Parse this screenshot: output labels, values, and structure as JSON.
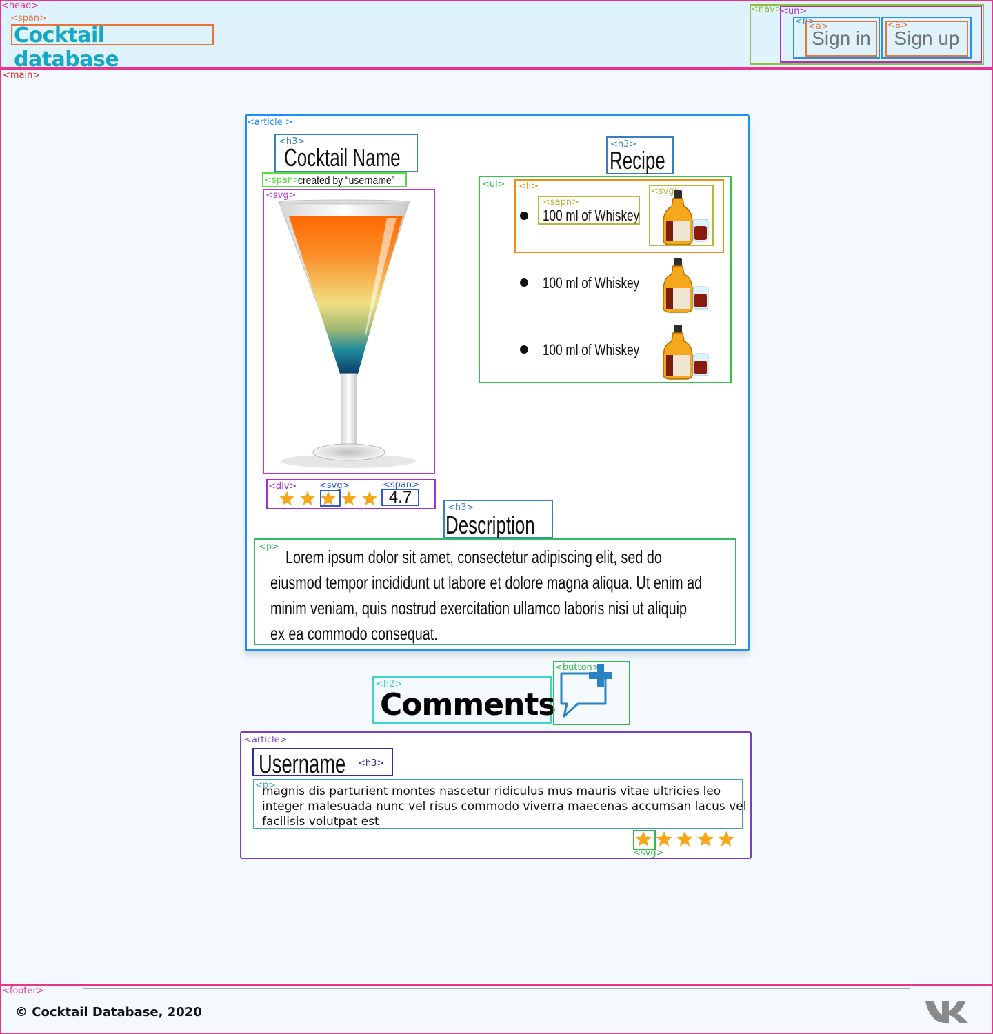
{
  "header": {
    "tag": "<head>",
    "brand_tag": "<span>",
    "brand": "Cocktail database",
    "nav_tag": "<nav>",
    "list_tag": "<un>",
    "item_tag": "<li>",
    "link_tag": "<a>",
    "links": [
      "Sign in",
      "Sign up"
    ]
  },
  "main": {
    "tag": "<main>",
    "article_tag": "<article >",
    "h3_tag": "<h3>",
    "cocktail_name": "Cocktail Name",
    "span_tag": "<span>",
    "created_by": "created by “username”",
    "svg_tag": "<svg>",
    "rating": {
      "div_tag": "<div>",
      "svg_tag": "<svg>",
      "span_tag": "<span>",
      "value": "4.7",
      "stars": 5
    },
    "recipe": {
      "heading": "Recipe",
      "h3_tag": "<h3>",
      "ul_tag": "<ul>",
      "li_tag": "<li>",
      "span_tag": "<sapn>",
      "svg_tag": "<svg>",
      "items": [
        "100 ml of Whiskey",
        "100 ml of Whiskey",
        "100 ml of Whiskey"
      ]
    },
    "description": {
      "h3_tag": "<h3>",
      "heading": "Description",
      "p_tag": "<p>",
      "lines": [
        "Lorem ipsum dolor sit amet, consectetur adipiscing elit, sed do",
        "eiusmod tempor incididunt ut labore et dolore magna aliqua. Ut enim ad",
        "minim veniam, quis nostrud exercitation ullamco laboris nisi ut aliquip",
        "ex ea commodo consequat."
      ]
    },
    "comments": {
      "h2_tag": "<h2>",
      "heading": "Comments",
      "button_tag": "<button>",
      "article_tag": "<article>",
      "h3_tag": "<h3>",
      "p_tag": "<p>",
      "svg_tag": "<svg>",
      "username": "Username",
      "lines": [
        "magnis dis parturient montes nascetur ridiculus mus mauris vitae ultricies leo",
        "integer malesuada nunc vel risus commodo viverra maecenas accumsan lacus vel",
        "facilisis volutpat est"
      ],
      "stars": 5
    }
  },
  "footer": {
    "tag": "<footer>",
    "copyright": "© Cocktail Database, 2020",
    "social_icon": "vk-icon"
  },
  "colors": {
    "star": "#f5a81c",
    "accent": "#15a8c4",
    "header_bg": "#dff3fd",
    "page_bg": "#f4f9fd"
  }
}
